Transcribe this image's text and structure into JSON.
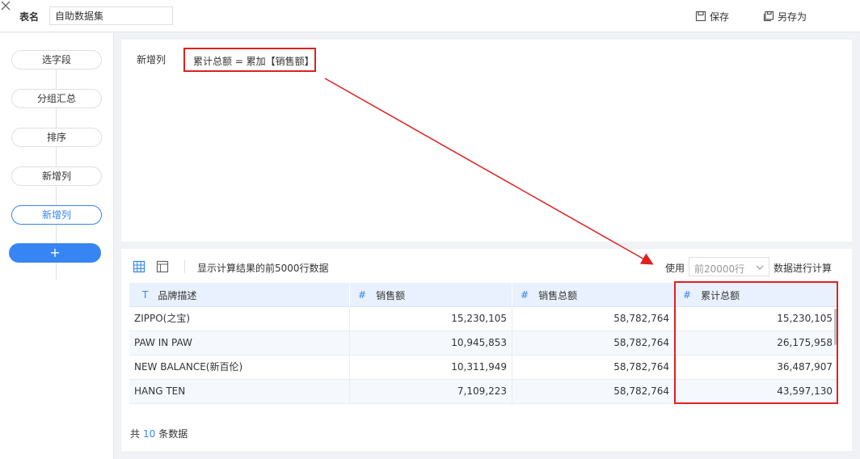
{
  "topbar": {
    "table_name_label": "表名",
    "table_name_value": "自助数据集",
    "save_label": "保存",
    "save_as_label": "另存为"
  },
  "sidebar": {
    "steps": [
      {
        "label": "选字段"
      },
      {
        "label": "分组汇总"
      },
      {
        "label": "排序"
      },
      {
        "label": "新增列"
      },
      {
        "label": "新增列",
        "active": true
      }
    ],
    "add_label": "+"
  },
  "formula": {
    "label": "新增列",
    "expression": "累计总额 = 累加【销售额】"
  },
  "data_panel": {
    "hint": "显示计算结果的前5000行数据",
    "use_label": "使用",
    "rows_select_value": "前20000行",
    "after_label": "数据进行计算",
    "columns": [
      {
        "type_icon": "T",
        "name": "品牌描述"
      },
      {
        "type_icon": "#",
        "name": "销售额"
      },
      {
        "type_icon": "#",
        "name": "销售总额"
      },
      {
        "type_icon": "#",
        "name": "累计总额"
      }
    ],
    "rows": [
      [
        "ZIPPO(之宝)",
        "15,230,105",
        "58,782,764",
        "15,230,105"
      ],
      [
        "PAW IN PAW",
        "10,945,853",
        "58,782,764",
        "26,175,958"
      ],
      [
        "NEW BALANCE(新百伦)",
        "10,311,949",
        "58,782,764",
        "36,487,907"
      ],
      [
        "HANG TEN",
        "7,109,223",
        "58,782,764",
        "43,597,130"
      ]
    ],
    "footer_prefix": "共",
    "footer_count": "10",
    "footer_suffix": "条数据"
  },
  "colors": {
    "accent": "#3685f2",
    "highlight_red": "#e02020",
    "header_bg": "#e8f1fd"
  }
}
